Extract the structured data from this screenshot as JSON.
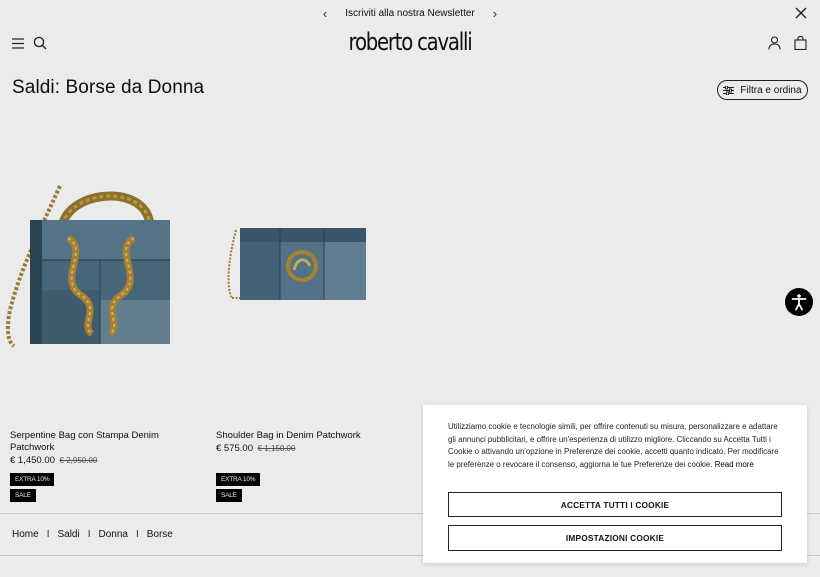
{
  "announcement": {
    "text": "Iscriviti alla nostra Newsletter",
    "prev_glyph": "‹",
    "next_glyph": "›"
  },
  "header": {
    "logo": "roberto cavalli"
  },
  "page": {
    "title": "Saldi: Borse da Donna",
    "filter_label": "Filtra e ordina"
  },
  "products": [
    {
      "name": "Serpentine Bag con Stampa Denim Patchwork",
      "price": "€ 1,450.00",
      "old_price": "€ 2,950.00",
      "badges": [
        "EXTRA 10%",
        "SALE"
      ]
    },
    {
      "name": "Shoulder Bag in Denim Patchwork",
      "price": "€ 575.00",
      "old_price": "€ 1,150.00",
      "badges": [
        "EXTRA 10%",
        "SALE"
      ]
    }
  ],
  "breadcrumb": [
    "Home",
    "Saldi",
    "Donna",
    "Borse"
  ],
  "breadcrumb_separator": "I",
  "cookie": {
    "text": "Utilizziamo cookie e tecnologie simili, per offrire contenuti su misura, personalizzare e adattare gli annunci pubblicitari, e offrire un'esperienza di utilizzo migliore. Cliccando su Accetta Tutti i Cookie o attivando un'opzione in Preferenze dei cookie, accetti quanto indicato. Per modificare le preferenze o revocare il consenso, aggiorna le tue Preferenze dei cookie.",
    "read_more": "Read more",
    "accept_label": "ACCETTA TUTTI I COOKIE",
    "settings_label": "IMPOSTAZIONI COOKIE"
  },
  "icons": {
    "close": "close-icon",
    "menu": "menu-icon",
    "search": "search-icon",
    "user": "user-icon",
    "bag": "bag-icon",
    "filter": "sliders-icon",
    "accessibility": "accessibility-icon"
  },
  "colors": {
    "text": "#111111",
    "badge_bg": "#000000",
    "badge_text": "#ffffff"
  }
}
